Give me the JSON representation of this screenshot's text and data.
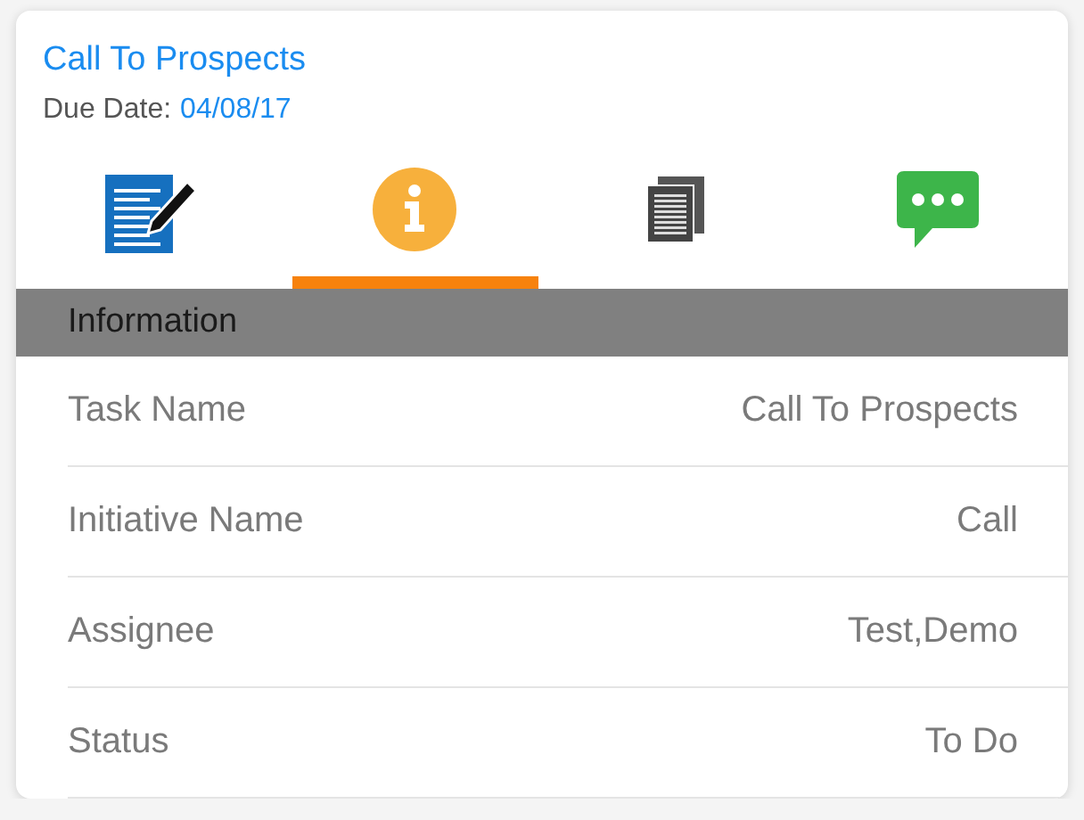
{
  "header": {
    "title": "Call To Prospects",
    "due_label": "Due Date:",
    "due_value": "04/08/17"
  },
  "tabs": [
    {
      "kind": "notes",
      "selected": false
    },
    {
      "kind": "info",
      "selected": true
    },
    {
      "kind": "documents",
      "selected": false
    },
    {
      "kind": "chat",
      "selected": false
    }
  ],
  "section": {
    "title": "Information"
  },
  "rows": [
    {
      "label": "Task Name",
      "value": "Call To Prospects"
    },
    {
      "label": "Initiative Name",
      "value": "Call"
    },
    {
      "label": "Assignee",
      "value": "Test,Demo"
    },
    {
      "label": "Status",
      "value": "To Do"
    }
  ]
}
